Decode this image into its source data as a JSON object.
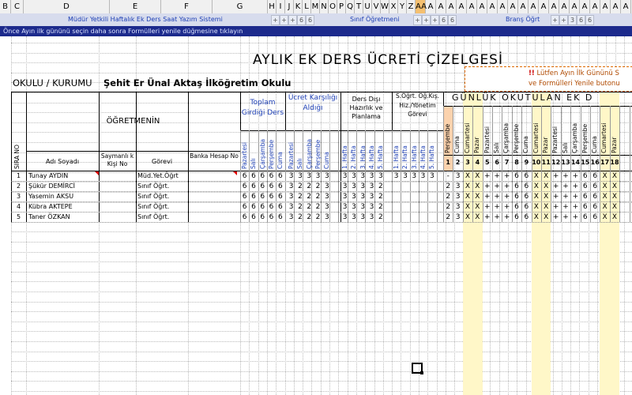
{
  "colheaders": {
    "letters": [
      "B",
      "C",
      "D",
      "E",
      "F",
      "G",
      "H",
      "I",
      "J",
      "K",
      "L",
      "M",
      "N",
      "O",
      "P",
      "Q",
      "T",
      "U",
      "V",
      "W",
      "X",
      "Y",
      "Z",
      "A",
      "A",
      "A",
      "A",
      "A",
      "A",
      "A",
      "A",
      "A",
      "A",
      "A",
      "A",
      "A",
      "A",
      "A",
      "A",
      "A",
      "A",
      "A",
      "A",
      "A",
      "A",
      "A",
      "A",
      "A",
      "A",
      "A"
    ],
    "selected_label": "AA"
  },
  "band1": {
    "system_label": "Müdür Yetkili Haftalık Ek Ders Saat Yazım Sistemi",
    "system_values": [
      "+",
      "+",
      "+",
      "6",
      "6"
    ],
    "sinif_label": "Sınıf Öğretmeni",
    "sinif_values": [
      "+",
      "+",
      "+",
      "6",
      "6"
    ],
    "brans_label": "Branş Öğrt",
    "brans_values": [
      "+",
      "+",
      "3",
      "6",
      "6"
    ]
  },
  "instruction": "Önce Ayın ilk gününü seçin daha sonra Formülleri yenile düğmesine tıklayın",
  "title": "AYLIK  EK DERS  ÜCRETİ  ÇİZELGESİ",
  "okul_label": "OKULU / KURUMU",
  "okul_value": "Şehit Er Ünal Aktaş İlköğretim Okulu",
  "callout": {
    "line1_mark": "!!",
    "line1": "Lütfen Ayın İlk Gününü S",
    "line2": "ve Formülleri Yenile butonu"
  },
  "headers": {
    "sira_no": "SIRA NO",
    "ogretmenin": "ÖĞRETMENİN",
    "adi_soyadi": "Adı Soyadı",
    "saymanlik": "Saymanlı k Kişi No",
    "gorevi": "Görevi",
    "banka": "Banka Hesap No",
    "toplam": "Toplam Girdiği Ders",
    "ucret": "Ücret Karşılığı Aldığı",
    "ders_disi": "Ders Dışı Hazırlık ve Planlama",
    "sogrt": "S.Öğrt. Öğ.Kış. Hiz./Yönetim Görevi",
    "gunluk": "GÜNLÜK  OKUTULAN  EK  D",
    "days5": [
      "Pazartesi",
      "Salı",
      "Çarşamba",
      "Perşembe",
      "Cuma"
    ],
    "weeks5": [
      "1. Hafta",
      "2. Hafta",
      "3. Hafta",
      "4. Hafta",
      "5. Hafta"
    ],
    "cal_days": [
      "Perşembe",
      "Cuma",
      "Cumartesi",
      "Pazar",
      "Pazartesi",
      "Salı",
      "Çarşamba",
      "Perşembe",
      "Cuma",
      "Cumartesi",
      "Pazar",
      "Pazartesi",
      "Salı",
      "Çarşamba",
      "Perşembe",
      "Cuma",
      "Cumartesi",
      "Pazar"
    ],
    "cal_nums": [
      "1",
      "2",
      "3",
      "4",
      "5",
      "6",
      "7",
      "8",
      "9",
      "10",
      "11",
      "12",
      "13",
      "14",
      "15",
      "16",
      "17",
      "18"
    ]
  },
  "rows": [
    {
      "no": "1",
      "ad": "Tunay AYDIN",
      "gorev": "Müd.Yet.Öğrt",
      "toplam": [
        "6",
        "6",
        "6",
        "6",
        "6"
      ],
      "ucret": [
        "3",
        "3",
        "3",
        "3",
        "3"
      ],
      "dd": [
        "3",
        "3",
        "3",
        "3",
        "3"
      ],
      "sg": [
        "3",
        "3",
        "3",
        "3",
        "3"
      ],
      "cal": [
        "-",
        "3",
        "X",
        "X",
        "+",
        "+",
        "+",
        "6",
        "6",
        "X",
        "X",
        "+",
        "+",
        "+",
        "6",
        "6",
        "X",
        "X"
      ]
    },
    {
      "no": "2",
      "ad": "Şükür DEMİRCİ",
      "gorev": "Sınıf Öğrt.",
      "toplam": [
        "6",
        "6",
        "6",
        "6",
        "6"
      ],
      "ucret": [
        "3",
        "2",
        "2",
        "2",
        "3"
      ],
      "dd": [
        "3",
        "3",
        "3",
        "3",
        "2"
      ],
      "sg": [
        "",
        "",
        "",
        "",
        ""
      ],
      "cal": [
        "2",
        "3",
        "X",
        "X",
        "+",
        "+",
        "+",
        "6",
        "6",
        "X",
        "X",
        "+",
        "+",
        "+",
        "6",
        "6",
        "X",
        "X"
      ]
    },
    {
      "no": "3",
      "ad": "Yasemin AKSU",
      "gorev": "Sınıf Öğrt.",
      "toplam": [
        "6",
        "6",
        "6",
        "6",
        "6"
      ],
      "ucret": [
        "3",
        "2",
        "2",
        "2",
        "3"
      ],
      "dd": [
        "3",
        "3",
        "3",
        "3",
        "2"
      ],
      "sg": [
        "",
        "",
        "",
        "",
        ""
      ],
      "cal": [
        "2",
        "3",
        "X",
        "X",
        "+",
        "+",
        "+",
        "6",
        "6",
        "X",
        "X",
        "+",
        "+",
        "+",
        "6",
        "6",
        "X",
        "X"
      ]
    },
    {
      "no": "4",
      "ad": "Kübra AKTEPE",
      "gorev": "Sınıf Öğrt.",
      "toplam": [
        "6",
        "6",
        "6",
        "6",
        "6"
      ],
      "ucret": [
        "3",
        "2",
        "2",
        "2",
        "3"
      ],
      "dd": [
        "3",
        "3",
        "3",
        "3",
        "2"
      ],
      "sg": [
        "",
        "",
        "",
        "",
        ""
      ],
      "cal": [
        "2",
        "3",
        "X",
        "X",
        "+",
        "+",
        "+",
        "6",
        "6",
        "X",
        "X",
        "+",
        "+",
        "+",
        "6",
        "6",
        "X",
        "X"
      ]
    },
    {
      "no": "5",
      "ad": "Taner ÖZKAN",
      "gorev": "Sınıf Öğrt.",
      "toplam": [
        "6",
        "6",
        "6",
        "6",
        "6"
      ],
      "ucret": [
        "3",
        "2",
        "2",
        "2",
        "3"
      ],
      "dd": [
        "3",
        "3",
        "3",
        "3",
        "2"
      ],
      "sg": [
        "",
        "",
        "",
        "",
        ""
      ],
      "cal": [
        "2",
        "3",
        "X",
        "X",
        "+",
        "+",
        "+",
        "6",
        "6",
        "X",
        "X",
        "+",
        "+",
        "+",
        "6",
        "6",
        "X",
        "X"
      ]
    }
  ]
}
